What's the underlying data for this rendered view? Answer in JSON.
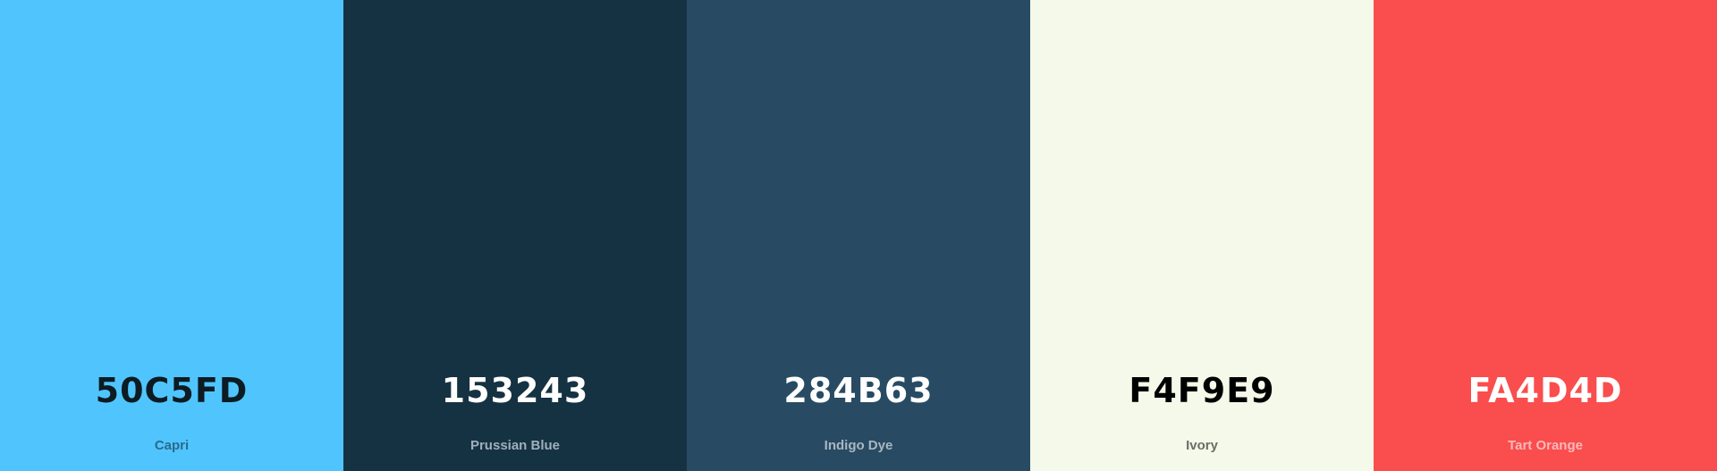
{
  "palette": {
    "swatches": [
      {
        "hex": "50C5FD",
        "name": "Capri",
        "color": "#50C5FD",
        "hex_text_color": "#0d1b22",
        "name_text_color": "#2a6b8c"
      },
      {
        "hex": "153243",
        "name": "Prussian Blue",
        "color": "#153243",
        "hex_text_color": "#ffffff",
        "name_text_color": "#9fb0ba"
      },
      {
        "hex": "284B63",
        "name": "Indigo Dye",
        "color": "#284B63",
        "hex_text_color": "#ffffff",
        "name_text_color": "#a9b7c1"
      },
      {
        "hex": "F4F9E9",
        "name": "Ivory",
        "color": "#F4F9E9",
        "hex_text_color": "#000000",
        "name_text_color": "#6b6e66"
      },
      {
        "hex": "FA4D4D",
        "name": "Tart Orange",
        "color": "#FA4D4D",
        "hex_text_color": "#ffffff",
        "name_text_color": "#fbb9b9"
      }
    ]
  }
}
